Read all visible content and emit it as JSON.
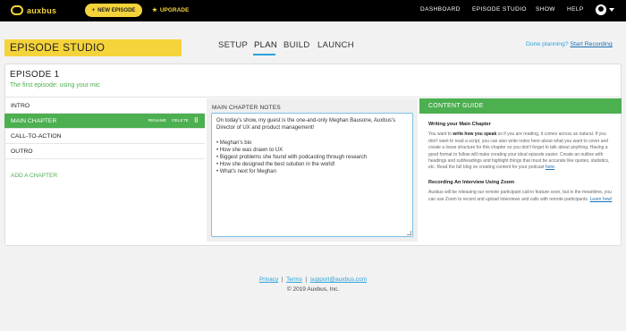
{
  "app": {
    "logo": "auxbus",
    "brand_color": "#f5d33a",
    "accent_green": "#4caf50",
    "link_blue": "#2aa3d9"
  },
  "topbar": {
    "new_episode": "NEW EPISODE",
    "upgrade": "UPGRADE",
    "nav": [
      "DASHBOARD",
      "EPISODE STUDIO",
      "SHOW",
      "HELP"
    ]
  },
  "studio": {
    "title": "EPISODE STUDIO",
    "tabs": [
      "SETUP",
      "PLAN",
      "BUILD",
      "LAUNCH"
    ],
    "active_tab": "PLAN",
    "done_planning_prefix": "Done planning?",
    "done_planning_link": "Start Recording"
  },
  "episode": {
    "title": "EPISODE 1",
    "subtitle": "The first episode: using your mic"
  },
  "chapters": {
    "items": [
      "INTRO",
      "MAIN CHAPTER",
      "CALL-TO-ACTION",
      "OUTRO"
    ],
    "active": "MAIN CHAPTER",
    "rename": "RENAME",
    "delete": "DELETE",
    "add": "ADD A CHAPTER"
  },
  "notes": {
    "label": "MAIN CHAPTER NOTES",
    "intro": "On today's show, my guest is the one-and-only Meghan Bausone, Auxbus's Director of UX and product management!",
    "bullets": [
      "• Meghan's bio",
      "• How she was drawn to UX",
      "• Biggest problems she found with podcasting through research",
      "• How she designed the best solution in the world!",
      "• What's next for Meghan"
    ]
  },
  "guide": {
    "title": "CONTENT GUIDE",
    "h1": "Writing your Main Chapter",
    "p1_a": "You want to ",
    "p1_bold": "write how you speak",
    "p1_b": " so if you are reading, it comes across as natural. If you don't want to read a script, you can also write notes here about what you want to cover and create a loose structure for this chapter so you don't forget to talk about anything. Having a good format to follow will make creating your ideal episode easier. Create an outline with headings and subheadings and highlight things that must be accurate like quotes, statistics, etc. Read the full blog on creating content for your podcast ",
    "p1_link": "here",
    "p1_end": ".",
    "h2": "Recording An Interview Using Zoom",
    "p2": "Auxbus will be releasing our remote participant call-in feature soon, but in the meantime, you can use Zoom to record and upload interviews and calls with remote participants. ",
    "p2_link": "Learn how!"
  },
  "footer": {
    "privacy": "Privacy",
    "terms": "Terms",
    "support": "support@auxbus.com",
    "sep": "|",
    "copyright": "© 2019 Auxbus, Inc."
  }
}
